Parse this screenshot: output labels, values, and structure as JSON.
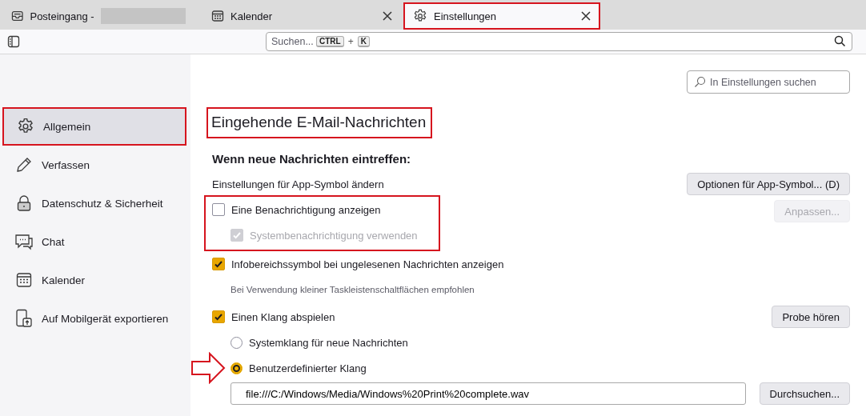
{
  "tabs": [
    {
      "label": "Posteingang -",
      "redacted": true,
      "selected": false,
      "closable": false,
      "highlighted": false
    },
    {
      "label": "Kalender",
      "redacted": false,
      "selected": false,
      "closable": true,
      "highlighted": false
    },
    {
      "label": "Einstellungen",
      "redacted": false,
      "selected": true,
      "closable": true,
      "highlighted": true
    }
  ],
  "toolbar": {
    "search": {
      "placeholder": "Suchen...",
      "keys": [
        {
          "kind": "key",
          "label": "CTRL"
        },
        {
          "kind": "text",
          "label": "+"
        },
        {
          "kind": "key",
          "label": "K"
        }
      ]
    }
  },
  "sidebar": {
    "items": [
      {
        "label": "Allgemein",
        "selected": true,
        "highlighted": true
      },
      {
        "label": "Verfassen",
        "selected": false,
        "highlighted": false
      },
      {
        "label": "Datenschutz & Sicherheit",
        "selected": false,
        "highlighted": false
      },
      {
        "label": "Chat",
        "selected": false,
        "highlighted": false
      },
      {
        "label": "Kalender",
        "selected": false,
        "highlighted": false
      },
      {
        "label": "Auf Mobilgerät exportieren",
        "selected": false,
        "highlighted": false
      }
    ]
  },
  "content": {
    "search": {
      "placeholder": "In Einstellungen suchen"
    },
    "heading": {
      "text": "Eingehende E-Mail-Nachrichten",
      "highlighted": true
    },
    "section_title": "Wenn neue Nachrichten eintreffen:",
    "rows": [
      {
        "kind": "text",
        "label": "Einstellungen für App-Symbol ändern",
        "button": {
          "label": "Optionen für App-Symbol... (D)",
          "disabled": false
        }
      },
      {
        "kind": "checkbox",
        "label": "Eine Benachrichtigung anzeigen",
        "checked": false,
        "disabled": false,
        "highlighted": true,
        "button": {
          "label": "Anpassen...",
          "disabled": true
        },
        "children": [
          {
            "kind": "checkbox",
            "label": "Systembenachrichtigung verwenden",
            "checked": true,
            "disabled": true
          }
        ]
      },
      {
        "kind": "checkbox",
        "label": "Infobereichssymbol bei ungelesenen Nachrichten anzeigen",
        "checked": true,
        "disabled": false,
        "highlighted": false,
        "children": [
          {
            "kind": "note",
            "label": "Bei Verwendung kleiner Taskleistenschaltflächen empfohlen"
          }
        ]
      },
      {
        "kind": "checkbox",
        "label": "Einen Klang abspielen",
        "checked": true,
        "disabled": false,
        "highlighted": false,
        "button": {
          "label": "Probe hören",
          "disabled": false
        },
        "children": [
          {
            "kind": "radio",
            "label": "Systemklang für neue Nachrichten",
            "selected": false,
            "arrow": false
          },
          {
            "kind": "radio",
            "label": "Benutzerdefinierter Klang",
            "selected": true,
            "arrow": true
          },
          {
            "kind": "file",
            "value": "file:///C:/Windows/Media/Windows%20Print%20complete.wav",
            "button": {
              "label": "Durchsuchen...",
              "disabled": false
            }
          }
        ]
      }
    ]
  }
}
